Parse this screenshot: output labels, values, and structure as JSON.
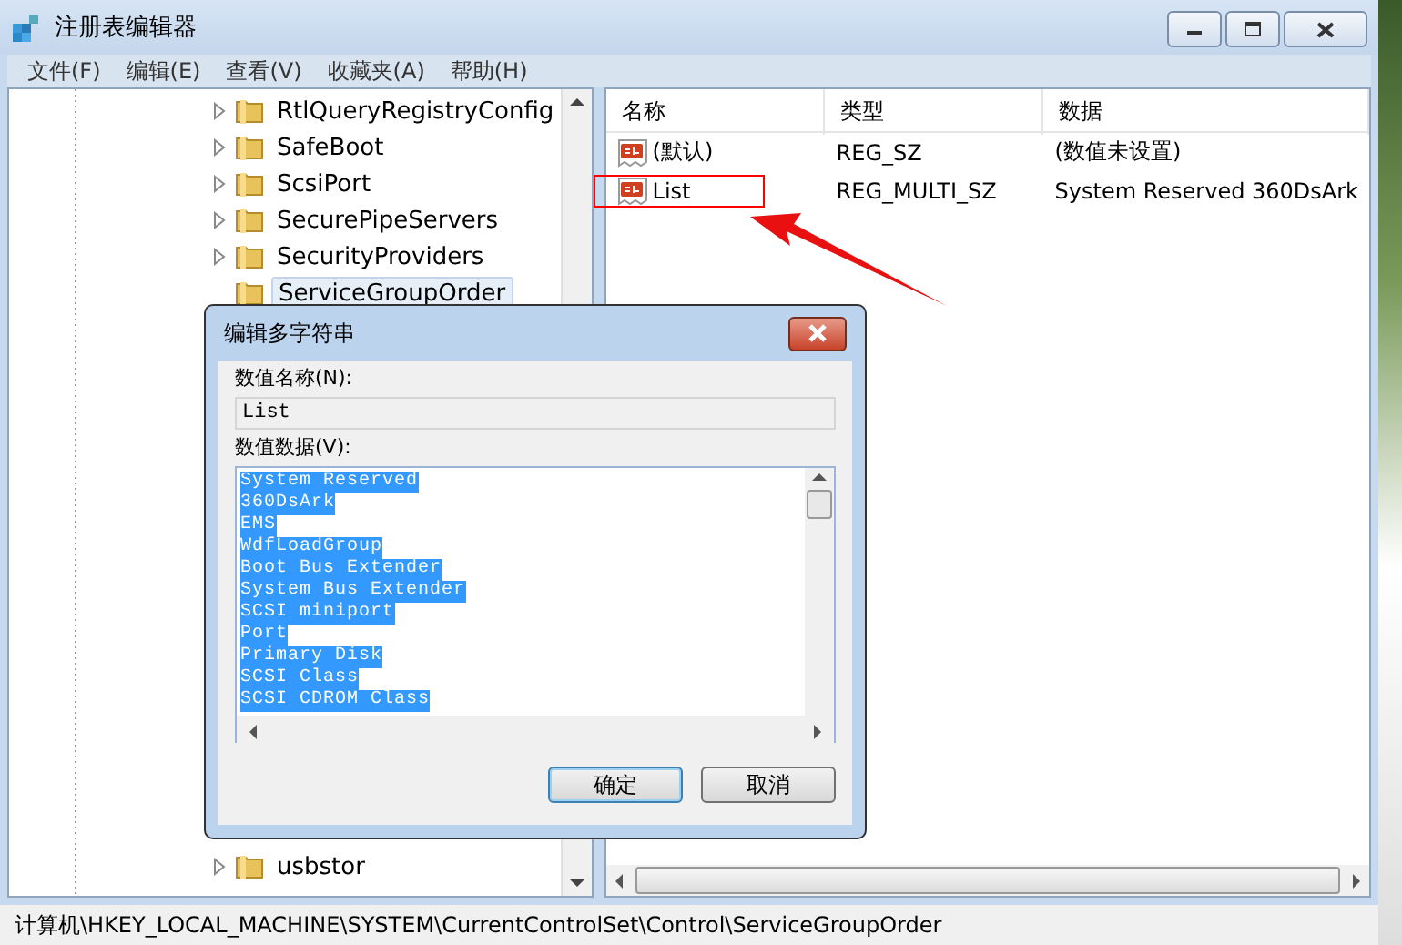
{
  "window": {
    "title": "注册表编辑器"
  },
  "menu": [
    {
      "label": "文件(F)"
    },
    {
      "label": "编辑(E)"
    },
    {
      "label": "查看(V)"
    },
    {
      "label": "收藏夹(A)"
    },
    {
      "label": "帮助(H)"
    }
  ],
  "tree": {
    "items": [
      {
        "label": "RtlQueryRegistryConfig",
        "expandable": true,
        "selected": false
      },
      {
        "label": "SafeBoot",
        "expandable": true,
        "selected": false
      },
      {
        "label": "ScsiPort",
        "expandable": true,
        "selected": false
      },
      {
        "label": "SecurePipeServers",
        "expandable": true,
        "selected": false
      },
      {
        "label": "SecurityProviders",
        "expandable": true,
        "selected": false
      },
      {
        "label": "ServiceGroupOrder",
        "expandable": false,
        "selected": true
      }
    ],
    "bottom_items": [
      {
        "label": "usbstor",
        "expandable": true,
        "selected": false
      }
    ]
  },
  "values": {
    "columns": [
      "名称",
      "类型",
      "数据"
    ],
    "rows": [
      {
        "name": "(默认)",
        "type": "REG_SZ",
        "data": "(数值未设置)",
        "highlighted": false
      },
      {
        "name": "List",
        "type": "REG_MULTI_SZ",
        "data": "System Reserved 360DsArk",
        "highlighted": true
      }
    ]
  },
  "dialog": {
    "title": "编辑多字符串",
    "name_label": "数值名称(N):",
    "name_value": "List",
    "data_label": "数值数据(V):",
    "data_lines": [
      "System Reserved",
      "360DsArk",
      "EMS",
      "WdfLoadGroup",
      "Boot Bus Extender",
      "System Bus Extender",
      "SCSI miniport",
      "Port",
      "Primary Disk",
      "SCSI Class",
      "SCSI CDROM Class"
    ],
    "buttons": [
      {
        "label": "确定",
        "default": true
      },
      {
        "label": "取消",
        "default": false
      }
    ]
  },
  "status_bar": "计算机\\HKEY_LOCAL_MACHINE\\SYSTEM\\CurrentControlSet\\Control\\ServiceGroupOrder"
}
